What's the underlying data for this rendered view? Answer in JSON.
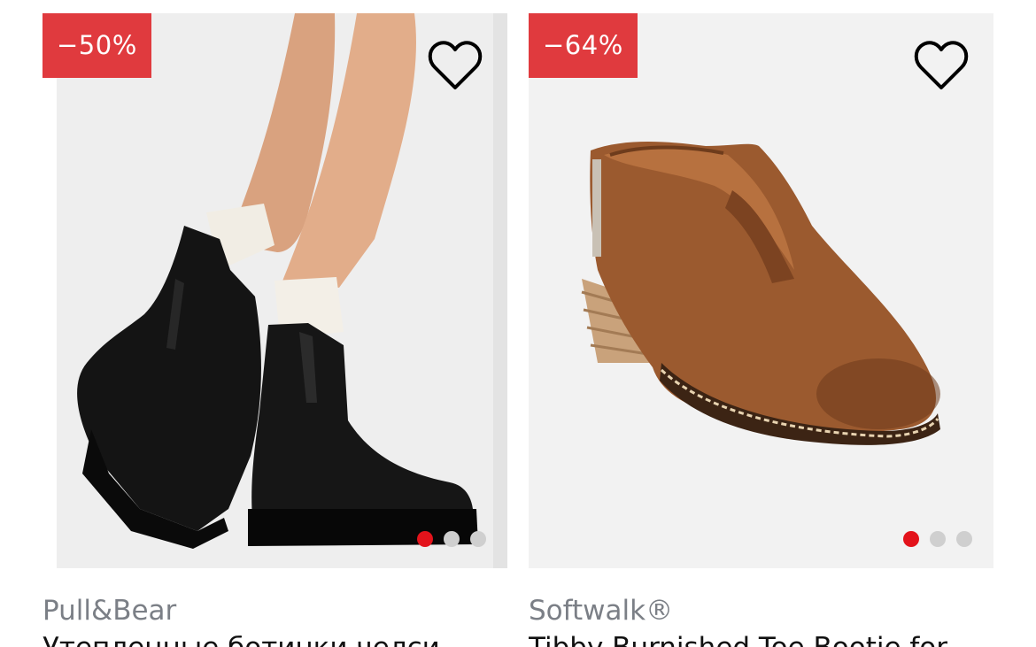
{
  "products": [
    {
      "discount": "−50%",
      "brand": "Pull&Bear",
      "title": "Утепленные ботинки челси",
      "image": "black-chelsea-boots-photo",
      "slides": 3,
      "active_slide": 1
    },
    {
      "discount": "−64%",
      "brand": "Softwalk®",
      "title": "Tibby Burnished Toe Bootie for",
      "image": "brown-suede-ankle-bootie-photo",
      "slides": 3,
      "active_slide": 1
    }
  ],
  "icons": {
    "favorite": "heart-outline-icon"
  },
  "colors": {
    "discount_bg": "#e03a3e",
    "active_dot": "#e3131b",
    "inactive_dot": "#cfcfcf",
    "brand_text": "#7b7f86"
  }
}
